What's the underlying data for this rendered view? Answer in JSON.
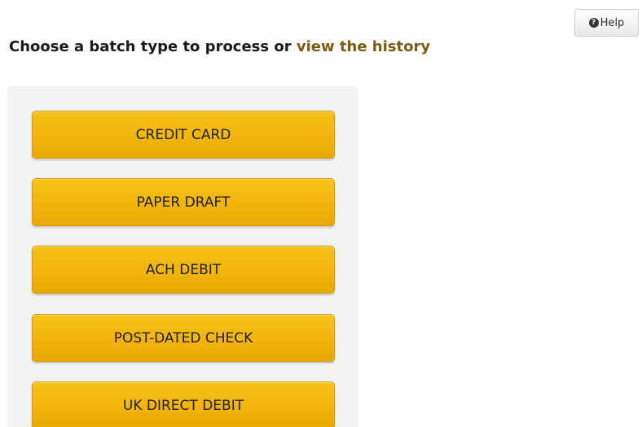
{
  "help": {
    "icon": "question-circle-icon",
    "label": "Help"
  },
  "heading": {
    "prefix": "Choose a batch type to process or ",
    "link": "view the history"
  },
  "batch_types": [
    {
      "label": "CREDIT CARD"
    },
    {
      "label": "PAPER DRAFT"
    },
    {
      "label": "ACH DEBIT"
    },
    {
      "label": "POST-DATED CHECK"
    },
    {
      "label": "UK DIRECT DEBIT"
    }
  ],
  "colors": {
    "button_gold": "#f2b40a",
    "link_brown": "#7a5c14",
    "panel_bg": "#f3f3f3"
  }
}
